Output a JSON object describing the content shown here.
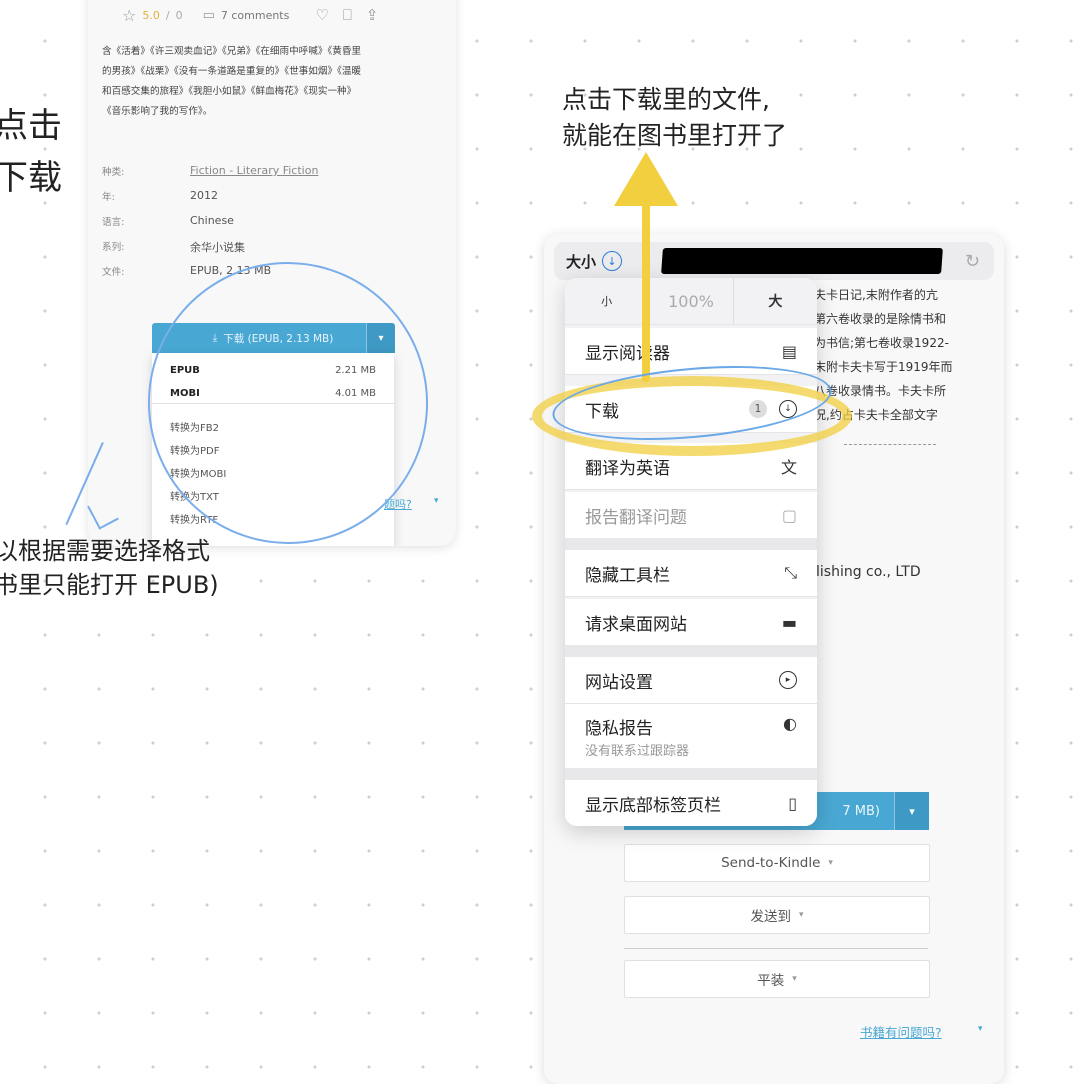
{
  "left_panel": {
    "rating": {
      "score": "5.0",
      "sep": "/",
      "total": "0"
    },
    "comments": "7 comments",
    "description_lines": [
      "含《活着》《许三观卖血记》《兄弟》《在细雨中呼喊》《黄昏里",
      "的男孩》《战栗》《没有一条道路是重复的》《世事如烟》《温暖",
      "和百感交集的旅程》《我胆小如鼠》《鲜血梅花》《现实一种》",
      "《音乐影响了我的写作》。"
    ],
    "meta": [
      {
        "key": "种类:",
        "value": "Fiction - Literary Fiction"
      },
      {
        "key": "年:",
        "value": "2012"
      },
      {
        "key": "语言:",
        "value": "Chinese"
      },
      {
        "key": "系列:",
        "value": "余华小说集"
      },
      {
        "key": "文件:",
        "value": "EPUB, 2.13 MB"
      }
    ],
    "download_button": "下载 (EPUB, 2.13 MB)",
    "download_options": [
      {
        "format": "EPUB",
        "size": "2.21 MB"
      },
      {
        "format": "MOBI",
        "size": "4.01 MB"
      }
    ],
    "convert_options": [
      "转换为FB2",
      "转换为PDF",
      "转换为MOBI",
      "转换为TXT",
      "转换为RTF"
    ],
    "bottom_link": "题吗?"
  },
  "annotations": {
    "left_big_1": "点击",
    "left_big_2": "下载",
    "left_caption_1": "以根据需要选择格式",
    "left_caption_2": "书里只能打开 EPUB)",
    "right_caption_1": "点击下载里的文件,",
    "right_caption_2": "就能在图书里打开了"
  },
  "right_panel": {
    "url_bar": {
      "text_size_label": "大小",
      "reload_icon": "reload-icon"
    },
    "background_text": [
      "夫卡日记,末附作者的亢",
      "第六卷收录的是除情书和",
      "为书信;第七卷收录1922-",
      "末附卡夫卡写于1919年而",
      "八卷收录情书。卡夫卡所",
      "况,约占卡夫卡全部文字"
    ],
    "publisher": "lishing co., LTD",
    "partial_download": "7 MB)",
    "send_to_kindle": "Send-to-Kindle",
    "send_to": "发送到",
    "binding": "平装",
    "bottom_link": "书籍有问题吗?",
    "menu": {
      "zoom_small": "小",
      "zoom_percent": "100%",
      "zoom_large": "大",
      "items": [
        {
          "label": "显示阅读器"
        },
        {
          "label": "下载",
          "badge": "1"
        },
        {
          "label": "翻译为英语"
        },
        {
          "label": "报告翻译问题"
        },
        {
          "label": "隐藏工具栏"
        },
        {
          "label": "请求桌面网站"
        },
        {
          "label": "网站设置"
        },
        {
          "label": "隐私报告",
          "sub": "没有联系过跟踪器"
        },
        {
          "label": "显示底部标签页栏"
        }
      ]
    }
  },
  "colors": {
    "accent_blue": "#49a8d3",
    "highlight_yellow": "#f1cf3f",
    "annotation_blue": "#6aa8e8"
  }
}
